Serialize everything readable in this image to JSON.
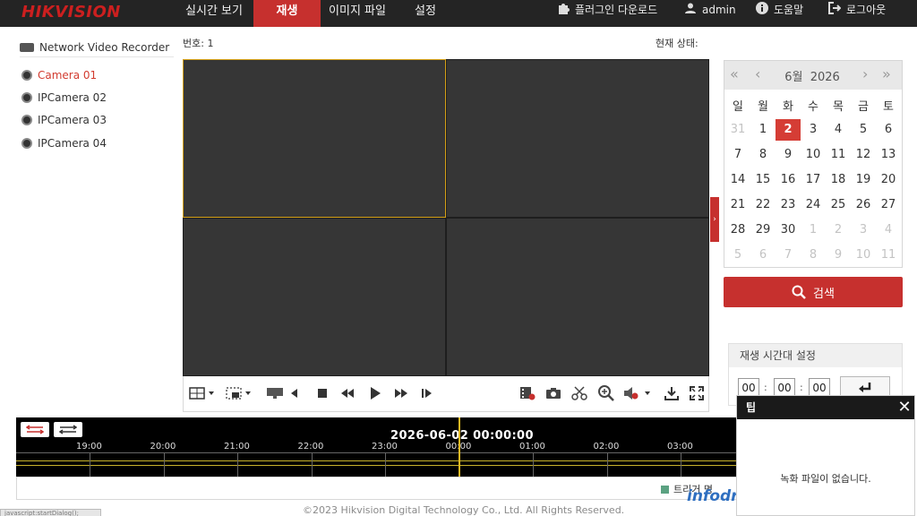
{
  "app": {
    "logo": "HIKVISION",
    "nav": [
      {
        "label": "실시간 보기",
        "active": false
      },
      {
        "label": "재생",
        "active": true
      },
      {
        "label": "이미지 파일",
        "active": false
      },
      {
        "label": "설정",
        "active": false
      }
    ],
    "plugin_download": "플러그인 다운로드",
    "user": "admin",
    "help": "도움말",
    "logout": "로그아웃"
  },
  "sidebar": {
    "title": "Network Video Recorder",
    "cameras": [
      {
        "label": "Camera 01",
        "active": true
      },
      {
        "label": "IPCamera 02",
        "active": false
      },
      {
        "label": "IPCamera 03",
        "active": false
      },
      {
        "label": "IPCamera 04",
        "active": false
      }
    ]
  },
  "main": {
    "number_label": "번호: 1",
    "status_label": "현재 상태:"
  },
  "toolbar_icons": [
    "layout-icon",
    "capture-area-icon",
    "stop-all-icon",
    "reverse-play-icon",
    "stop-icon",
    "slow-forward-icon",
    "play-icon",
    "fast-forward-icon",
    "single-frame-icon",
    "download-clip-icon",
    "snapshot-icon",
    "clip-icon",
    "digital-zoom-icon",
    "audio-icon",
    "download-icon",
    "fullscreen-icon"
  ],
  "calendar": {
    "month": "6월",
    "year": "2026",
    "weekdays": [
      "일",
      "월",
      "화",
      "수",
      "목",
      "금",
      "토"
    ],
    "selected_day": "2",
    "weeks": [
      [
        {
          "d": "31",
          "m": true
        },
        {
          "d": "1",
          "m": false
        },
        {
          "d": "2",
          "m": false
        },
        {
          "d": "3",
          "m": false
        },
        {
          "d": "4",
          "m": false
        },
        {
          "d": "5",
          "m": false
        },
        {
          "d": "6",
          "m": false
        }
      ],
      [
        {
          "d": "7",
          "m": false
        },
        {
          "d": "8",
          "m": false
        },
        {
          "d": "9",
          "m": false
        },
        {
          "d": "10",
          "m": false
        },
        {
          "d": "11",
          "m": false
        },
        {
          "d": "12",
          "m": false
        },
        {
          "d": "13",
          "m": false
        }
      ],
      [
        {
          "d": "14",
          "m": false
        },
        {
          "d": "15",
          "m": false
        },
        {
          "d": "16",
          "m": false
        },
        {
          "d": "17",
          "m": false
        },
        {
          "d": "18",
          "m": false
        },
        {
          "d": "19",
          "m": false
        },
        {
          "d": "20",
          "m": false
        }
      ],
      [
        {
          "d": "21",
          "m": false
        },
        {
          "d": "22",
          "m": false
        },
        {
          "d": "23",
          "m": false
        },
        {
          "d": "24",
          "m": false
        },
        {
          "d": "25",
          "m": false
        },
        {
          "d": "26",
          "m": false
        },
        {
          "d": "27",
          "m": false
        }
      ],
      [
        {
          "d": "28",
          "m": false
        },
        {
          "d": "29",
          "m": false
        },
        {
          "d": "30",
          "m": false
        },
        {
          "d": "1",
          "m": true
        },
        {
          "d": "2",
          "m": true
        },
        {
          "d": "3",
          "m": true
        },
        {
          "d": "4",
          "m": true
        }
      ],
      [
        {
          "d": "5",
          "m": true
        },
        {
          "d": "6",
          "m": true
        },
        {
          "d": "7",
          "m": true
        },
        {
          "d": "8",
          "m": true
        },
        {
          "d": "9",
          "m": true
        },
        {
          "d": "10",
          "m": true
        },
        {
          "d": "11",
          "m": true
        }
      ]
    ]
  },
  "search_label": "검색",
  "time_panel": {
    "title": "재생 시간대 설정",
    "hour": "00",
    "minute": "00",
    "second": "00"
  },
  "timeline": {
    "datetime": "2026-06-02 00:00:00",
    "hours": [
      "19:00",
      "20:00",
      "21:00",
      "22:00",
      "23:00",
      "00:00",
      "01:00",
      "02:00",
      "03:00"
    ],
    "legend": "트리거 명",
    "legend_color": "#5ba282"
  },
  "tip": {
    "title": "팁",
    "message": "녹화 파일이 없습니다."
  },
  "watermarks": [
    "infodrive",
    "infodrive"
  ],
  "footer": "©2023 Hikvision Digital Technology Co., Ltd. All Rights Reserved.",
  "status_bar": "javascript:startDialog();",
  "colors": {
    "brand": "#c6302e",
    "topbar": "#242424",
    "selected_day": "#d53d35",
    "selected_window": "#d4a017",
    "timeline_cursor": "#e3b823"
  }
}
